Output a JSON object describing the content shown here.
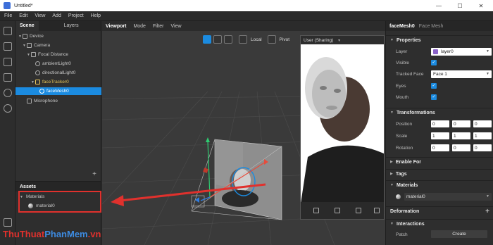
{
  "window": {
    "title": "Untitled*",
    "minimize": "—",
    "maximize": "☐",
    "close": "✕"
  },
  "menu": [
    "File",
    "Edit",
    "View",
    "Add",
    "Project",
    "Help"
  ],
  "scene_panel": {
    "tabs": [
      "Scene",
      "Layers"
    ],
    "tree": [
      {
        "label": "Device",
        "icon": "device-icon"
      },
      {
        "label": "Camera",
        "icon": "camera-icon"
      },
      {
        "label": "Focal Distance",
        "icon": "focal-distance-icon"
      },
      {
        "label": "ambientLight0",
        "icon": "light-icon"
      },
      {
        "label": "directionalLight0",
        "icon": "light-icon"
      },
      {
        "label": "faceTracker0",
        "icon": "face-tracker-icon"
      },
      {
        "label": "faceMesh0",
        "icon": "face-mesh-icon"
      },
      {
        "label": "Microphone",
        "icon": "microphone-icon"
      }
    ],
    "add": "+"
  },
  "assets_panel": {
    "title": "Assets",
    "group": "Materials",
    "items": [
      "material0"
    ]
  },
  "viewport": {
    "tabs": [
      "Viewport",
      "Mode",
      "Filter",
      "View"
    ],
    "local_label": "Local",
    "pivot_label": "Pivot"
  },
  "preview": {
    "device_label": "User (Sharing)"
  },
  "properties": {
    "object_name": "faceMesh0",
    "object_type": "Face Mesh",
    "sections": {
      "properties": "Properties",
      "transformations": "Transformations",
      "enable_for": "Enable For",
      "tags": "Tags",
      "materials": "Materials",
      "deformation": "Deformation",
      "interactions": "Interactions"
    },
    "layer_label": "Layer",
    "layer_value": "layer0",
    "layer_color": "#8b63c9",
    "visible_label": "Visible",
    "tracked_face_label": "Tracked Face",
    "tracked_face_value": "Face 1",
    "eyes_label": "Eyes",
    "mouth_label": "Mouth",
    "position_label": "Position",
    "position": [
      "0",
      "0",
      "0"
    ],
    "scale_label": "Scale",
    "scale": [
      "1",
      "1",
      "1"
    ],
    "rotation_label": "Rotation",
    "rotation": [
      "0",
      "0",
      "0"
    ],
    "material_value": "material0",
    "patch_label": "Patch",
    "create_label": "Create",
    "add": "+"
  },
  "watermark": {
    "part1": "Thu",
    "part2": "Thuat",
    "part3": "PhanMem",
    "part4": ".vn"
  },
  "colors": {
    "accent": "#1b8be0",
    "highlight": "#e0312d",
    "arrow": "#e0312d"
  }
}
